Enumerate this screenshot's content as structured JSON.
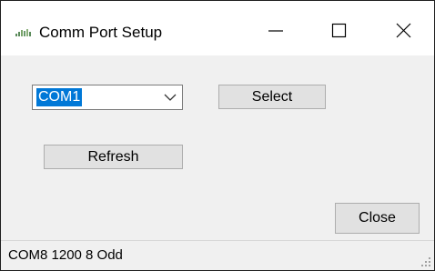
{
  "window": {
    "title": "Comm Port Setup",
    "icon": "app-icon"
  },
  "caption_buttons": {
    "minimize_icon": "minimize-icon",
    "maximize_icon": "maximize-icon",
    "close_icon": "close-icon"
  },
  "port_select": {
    "value": "COM1",
    "arrow_icon": "chevron-down-icon"
  },
  "buttons": {
    "select_label": "Select",
    "refresh_label": "Refresh",
    "close_label": "Close"
  },
  "status": {
    "text": "COM8 1200 8 Odd"
  },
  "colors": {
    "selection": "#0078d7",
    "button_face": "#e1e1e1",
    "dialog_bg": "#f0f0f0"
  }
}
